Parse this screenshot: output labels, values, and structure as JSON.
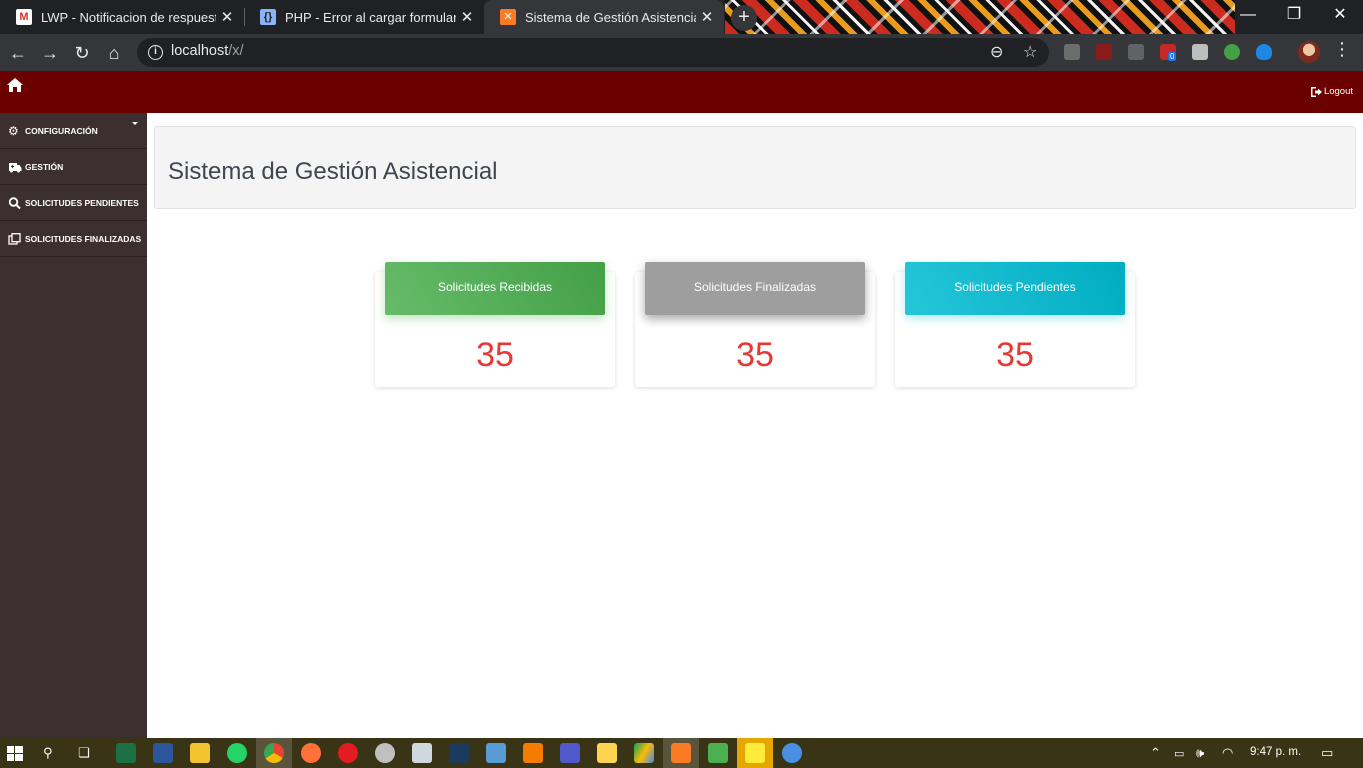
{
  "browser": {
    "tabs": [
      {
        "title": "LWP - Notificacion de respuesta c",
        "icon": "gmail-icon"
      },
      {
        "title": "PHP - Error al cargar formulario",
        "icon": "brackets-icon"
      },
      {
        "title": "Sistema de Gestión Asistencial",
        "icon": "xampp-icon",
        "active": true
      }
    ],
    "new_tab": "+",
    "url_host": "localhost",
    "url_path": "/x/",
    "extension_badge": "0"
  },
  "app": {
    "logout_label": "Logout",
    "sidebar": [
      {
        "label": "CONFIGURACIÓN",
        "icon": "cogs-icon",
        "has_caret": true
      },
      {
        "label": "GESTIÓN",
        "icon": "ambulance-icon"
      },
      {
        "label": "SOLICITUDES PENDIENTES",
        "icon": "search-icon"
      },
      {
        "label": "SOLICITUDES FINALIZADAS",
        "icon": "clone-icon"
      }
    ],
    "page_title": "Sistema de Gestión Asistencial",
    "cards": [
      {
        "label": "Solicitudes Recibidas",
        "value": "35",
        "color": "#4caf50"
      },
      {
        "label": "Solicitudes Finalizadas",
        "value": "35",
        "color": "#9e9e9e"
      },
      {
        "label": "Solicitudes Pendientes",
        "value": "35",
        "color": "#00bcd4"
      }
    ],
    "colors": {
      "header": "#6b0000",
      "sidebar": "#3b2f2f",
      "value_red": "#e53935"
    }
  },
  "taskbar": {
    "clock": "9:47 p. m."
  }
}
